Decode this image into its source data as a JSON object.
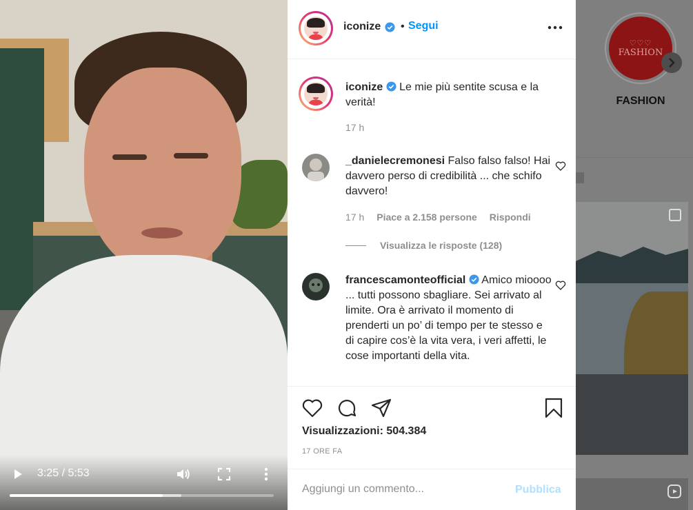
{
  "background": {
    "highlight_label": "FASHION",
    "highlight_cover_text": "FASHION",
    "highlight_cover_hearts": "♡♡♡"
  },
  "video": {
    "current_time": "3:25",
    "duration": "5:53",
    "time_display": "3:25 / 5:53",
    "progress": 0.58,
    "buffered": 0.65
  },
  "post": {
    "author": "iconize",
    "follow_label": "Segui",
    "separator": "•",
    "caption_text": "Le mie più sentite scusa e la verità!",
    "caption_time": "17 h",
    "comments": [
      {
        "username": "_danielecremonesi",
        "text": "Falso falso falso! Hai davvero perso di credibilità ... che schifo davvero!",
        "time": "17 h",
        "likes": "Piace a 2.158 persone",
        "reply_label": "Rispondi",
        "view_replies": "Visualizza le risposte (128)"
      },
      {
        "username": "francescamonteofficial",
        "text": "Amico mioooo ... tutti possono sbagliare. Sei arrivato al limite. Ora è arrivato il momento di prenderti un po’ di tempo per te stesso e di capire cos’è la vita vera, i veri affetti, le cose importanti della vita."
      }
    ],
    "views_label": "Visualizzazioni: 504.384",
    "posted_ago": "17 ORE FA",
    "comment_placeholder": "Aggiungi un commento...",
    "publish_label": "Pubblica"
  },
  "colors": {
    "accent": "#0095f6",
    "publish_disabled": "#b2dffc",
    "text": "#262626",
    "muted": "#8e8e8e"
  },
  "icons": [
    "play-icon",
    "volume-icon",
    "fullscreen-icon",
    "more-vertical-icon",
    "verified-icon",
    "more-horizontal-icon",
    "heart-icon",
    "comment-icon",
    "share-icon",
    "bookmark-icon",
    "chevron-right-icon",
    "reels-icon"
  ]
}
